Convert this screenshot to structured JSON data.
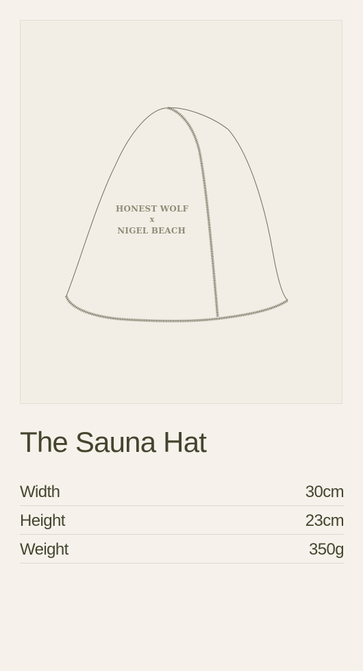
{
  "product": {
    "image_logo_line1": "HONEST WOLF",
    "image_logo_line2": "x",
    "image_logo_line3": "NIGEL BEACH",
    "title": "The Sauna Hat"
  },
  "specs": [
    {
      "label": "Width",
      "value": "30cm"
    },
    {
      "label": "Height",
      "value": "23cm"
    },
    {
      "label": "Weight",
      "value": "350g"
    }
  ],
  "colors": {
    "background": "#f6f2eb",
    "image_background": "#f2eee6",
    "text": "#45452f",
    "divider": "#ddd8ce"
  },
  "icons": [
    "sauna-hat-illustration"
  ]
}
